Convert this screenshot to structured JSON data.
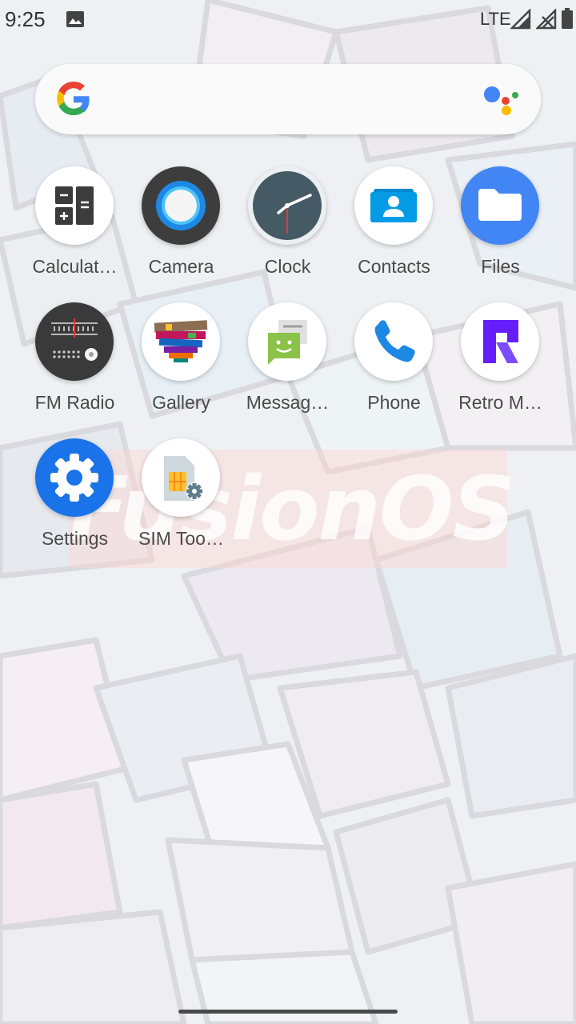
{
  "status_bar": {
    "time": "9:25",
    "network_type": "LTE",
    "icons": [
      "gallery-notification-icon",
      "signal-icon",
      "signal-no-service-icon",
      "battery-icon"
    ]
  },
  "search_bar": {
    "logo": "google-logo-icon",
    "assistant": "google-assistant-icon"
  },
  "watermark": {
    "text": "FusionOS"
  },
  "apps": [
    {
      "label": "Calculat…",
      "icon": "calculator-icon"
    },
    {
      "label": "Camera",
      "icon": "camera-icon"
    },
    {
      "label": "Clock",
      "icon": "clock-icon"
    },
    {
      "label": "Contacts",
      "icon": "contacts-icon"
    },
    {
      "label": "Files",
      "icon": "files-icon"
    },
    {
      "label": "FM Radio",
      "icon": "fm-radio-icon"
    },
    {
      "label": "Gallery",
      "icon": "gallery-icon"
    },
    {
      "label": "Messag…",
      "icon": "messaging-icon"
    },
    {
      "label": "Phone",
      "icon": "phone-icon"
    },
    {
      "label": "Retro M…",
      "icon": "retro-music-icon"
    },
    {
      "label": "Settings",
      "icon": "settings-icon"
    },
    {
      "label": "SIM Too…",
      "icon": "sim-toolkit-icon"
    }
  ],
  "colors": {
    "google_blue": "#4285F4",
    "google_red": "#EA4335",
    "google_yellow": "#FBBC05",
    "google_green": "#34A853",
    "label_text": "#4a4a4a"
  }
}
